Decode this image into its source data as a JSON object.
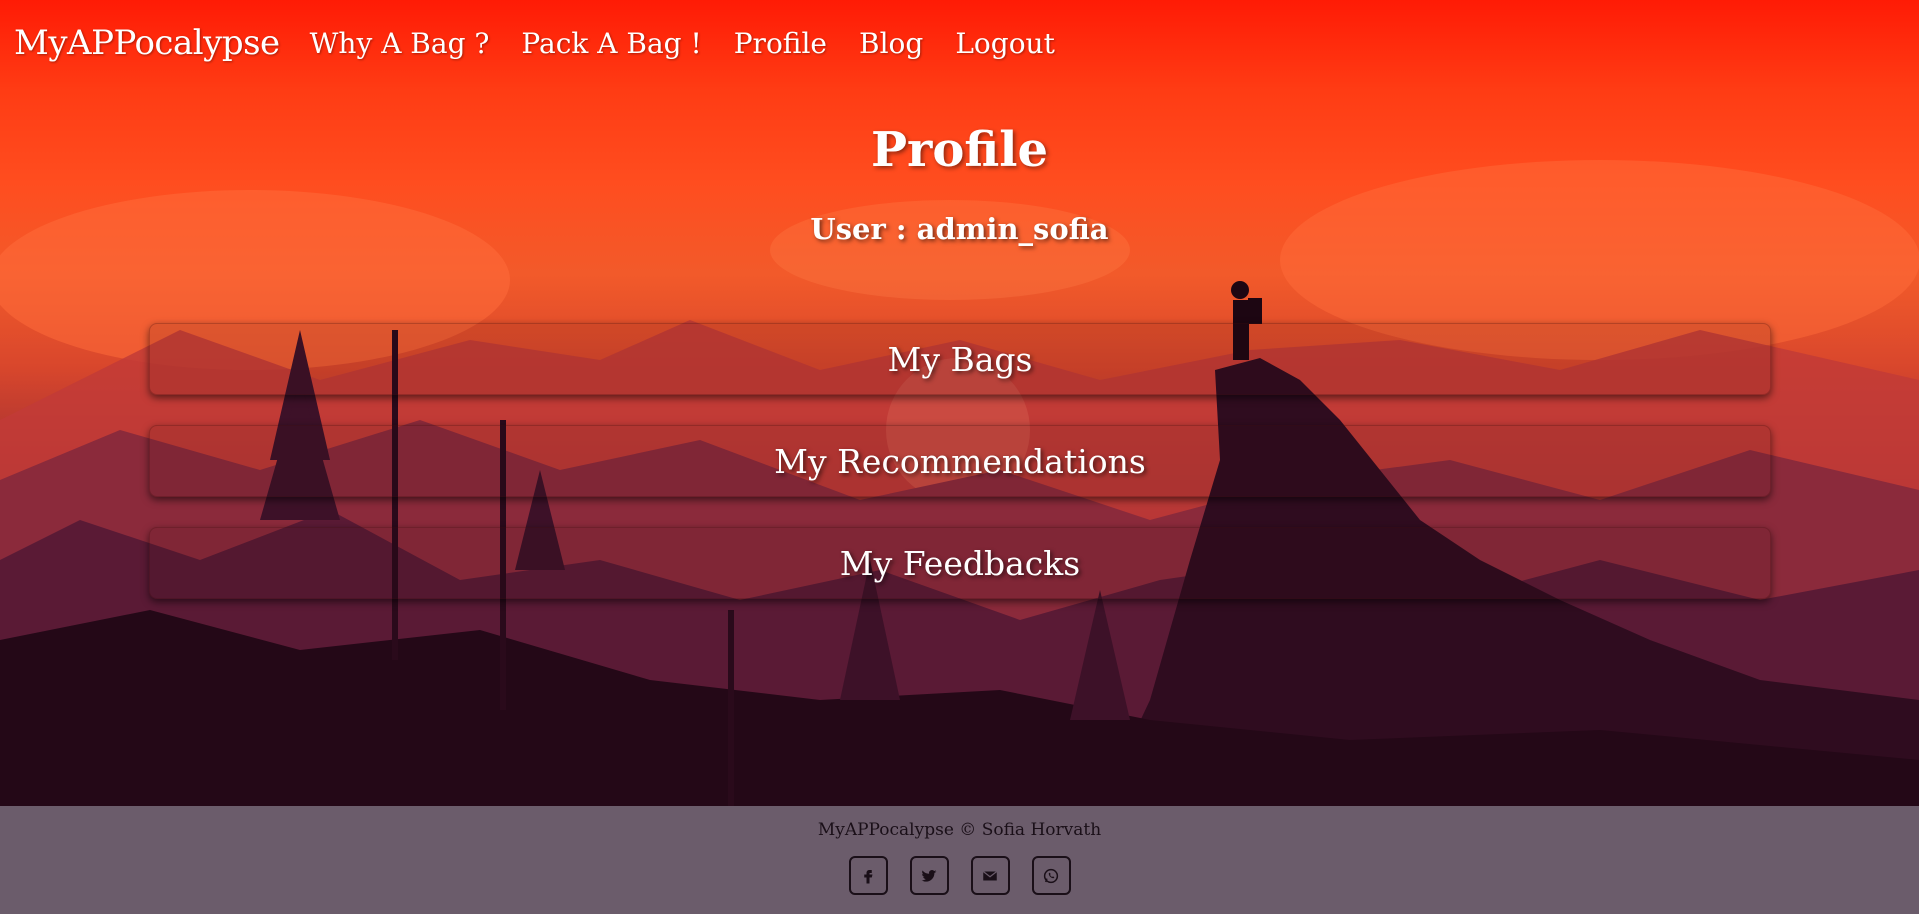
{
  "navbar": {
    "brand": "MyAPPocalypse",
    "links": [
      {
        "label": "Why A Bag ?"
      },
      {
        "label": "Pack A Bag !"
      },
      {
        "label": "Profile"
      },
      {
        "label": "Blog"
      },
      {
        "label": "Logout"
      }
    ]
  },
  "main": {
    "title": "Profile",
    "user_label": "User :",
    "username": "admin_sofia",
    "buttons": {
      "bags": "My Bags",
      "recommendations": "My Recommendations",
      "feedbacks": "My Feedbacks"
    }
  },
  "footer": {
    "copyright": "MyAPPocalypse © Sofia Horvath",
    "socials": [
      {
        "icon": "facebook-icon"
      },
      {
        "icon": "twitter-icon"
      },
      {
        "icon": "email-icon"
      },
      {
        "icon": "whatsapp-icon"
      }
    ]
  },
  "colors": {
    "sky_top": "#ff1b05",
    "footer_bg": "#6b5c6b",
    "text_light": "#ffffff",
    "text_dark": "#1a0f18"
  }
}
